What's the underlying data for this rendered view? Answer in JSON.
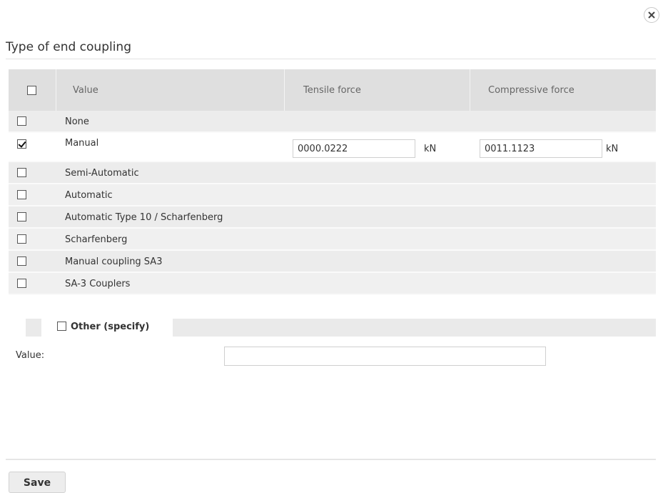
{
  "dialog": {
    "title": "Type of end coupling",
    "close_icon": "close-icon"
  },
  "table": {
    "headers": {
      "value": "Value",
      "tensile": "Tensile force",
      "compressive": "Compressive force"
    },
    "rows": [
      {
        "label": "None",
        "checked": false
      },
      {
        "label": "Manual",
        "checked": true,
        "tensile": "0000.0222",
        "tensile_unit": "kN",
        "compressive": "0011.1123",
        "compressive_unit": "kN"
      },
      {
        "label": "Semi-Automatic",
        "checked": false
      },
      {
        "label": "Automatic",
        "checked": false
      },
      {
        "label": "Automatic Type 10 / Scharfenberg",
        "checked": false
      },
      {
        "label": "Scharfenberg",
        "checked": false
      },
      {
        "label": "Manual coupling SA3",
        "checked": false
      },
      {
        "label": "SA-3 Couplers",
        "checked": false
      }
    ]
  },
  "other": {
    "label": "Other (specify)",
    "checked": false,
    "value_label": "Value:",
    "value": ""
  },
  "footer": {
    "save_label": "Save"
  }
}
